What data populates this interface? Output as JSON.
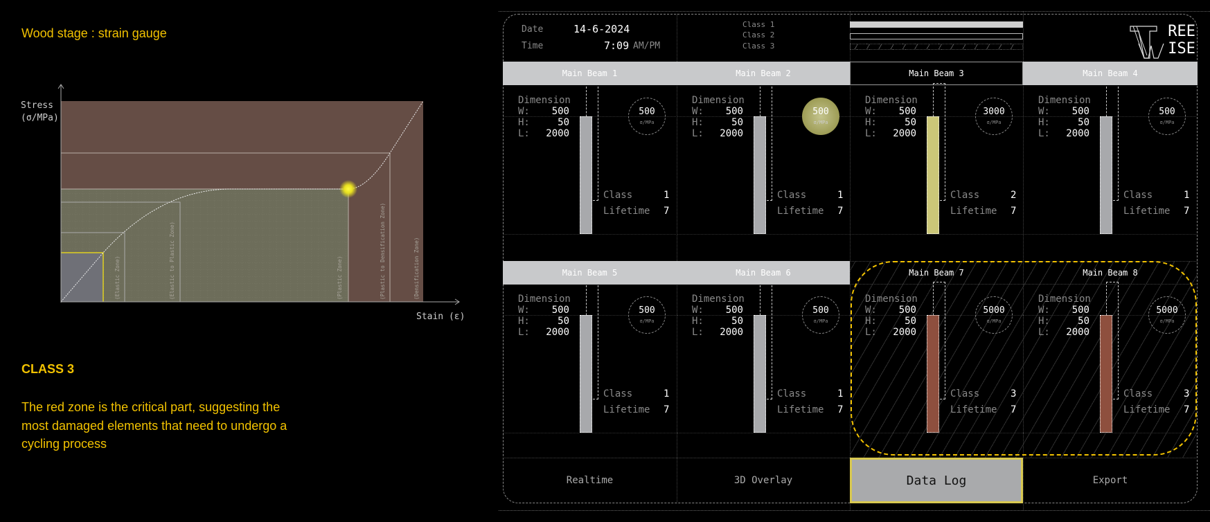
{
  "left": {
    "title": "Wood stage :  strain gauge",
    "class_heading": "CLASS 3",
    "description_lines": [
      "The red zone is the critical part, suggesting the",
      "most damaged elements that need to undergo a",
      "cycling process"
    ]
  },
  "chart_data": {
    "type": "line",
    "title": "",
    "ylabel_line1": "Stress",
    "ylabel_line2": "(σ/MPa)",
    "xlabel": "Stain (ε)",
    "grid": true,
    "zones": [
      "(Elastic Zone)",
      "(Elastic to Plastic Zone)",
      "(Plastic Zone)",
      "(Plastic to Densification Zone)",
      "(Densification Zone)"
    ],
    "colors": {
      "critical": "#654d45",
      "safe": "#6d6d5a",
      "elastic": "#6f7077",
      "marker": "#f5ee2a",
      "highlight": "#e0d020"
    }
  },
  "header": {
    "date_label": "Date",
    "date": "14-6-2024",
    "time_label": "Time",
    "time": "7:09",
    "ampm": "AM/PM",
    "legend": [
      "Class 1",
      "Class 2",
      "Class 3"
    ],
    "logo_top": "REE",
    "logo_bottom": "ISE",
    "logo_text": "TREE WISE"
  },
  "labels": {
    "dimension": "Dimension",
    "w": "W:",
    "h": "H:",
    "l": "L:",
    "class": "Class",
    "lifetime": "Lifetime",
    "unit": "σ/MPa"
  },
  "beams": [
    {
      "name": "Main Beam 1",
      "w": "500",
      "h": "50",
      "l": "2000",
      "stress": "500",
      "class": "1",
      "lifetime": "7",
      "header": "fill",
      "bar": "#a8a9ac",
      "circle": "plain"
    },
    {
      "name": "Main Beam 2",
      "w": "500",
      "h": "50",
      "l": "2000",
      "stress": "500",
      "class": "1",
      "lifetime": "7",
      "header": "fill",
      "bar": "#a8a9ac",
      "circle": "hot"
    },
    {
      "name": "Main Beam 3",
      "w": "500",
      "h": "50",
      "l": "2000",
      "stress": "3000",
      "class": "2",
      "lifetime": "7",
      "header": "sel",
      "bar": "#cbc778",
      "circle": "plain"
    },
    {
      "name": "Main Beam 4",
      "w": "500",
      "h": "50",
      "l": "2000",
      "stress": "500",
      "class": "1",
      "lifetime": "7",
      "header": "fill",
      "bar": "#a8a9ac",
      "circle": "plain"
    },
    {
      "name": "Main Beam 5",
      "w": "500",
      "h": "50",
      "l": "2000",
      "stress": "500",
      "class": "1",
      "lifetime": "7",
      "header": "fill",
      "bar": "#a8a9ac",
      "circle": "plain"
    },
    {
      "name": "Main Beam 6",
      "w": "500",
      "h": "50",
      "l": "2000",
      "stress": "500",
      "class": "1",
      "lifetime": "7",
      "header": "fill",
      "bar": "#a8a9ac",
      "circle": "plain"
    },
    {
      "name": "Main Beam 7",
      "w": "500",
      "h": "50",
      "l": "2000",
      "stress": "5000",
      "class": "3",
      "lifetime": "7",
      "header": "none",
      "bar": "#8e4f3e",
      "circle": "plain"
    },
    {
      "name": "Main Beam 8",
      "w": "500",
      "h": "50",
      "l": "2000",
      "stress": "5000",
      "class": "3",
      "lifetime": "7",
      "header": "none",
      "bar": "#8e4f3e",
      "circle": "plain"
    }
  ],
  "buttons": [
    {
      "label": "Realtime",
      "active": false
    },
    {
      "label": "3D Overlay",
      "active": false
    },
    {
      "label": "Data Log",
      "active": true
    },
    {
      "label": "Export",
      "active": false
    }
  ],
  "accent": "#f2c200"
}
